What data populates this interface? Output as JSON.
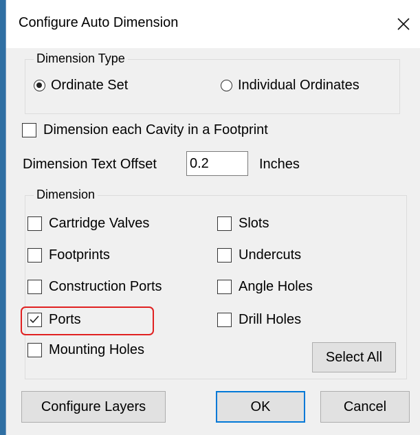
{
  "window": {
    "title": "Configure Auto Dimension",
    "close_icon": "close-icon"
  },
  "dimension_type": {
    "label": "Dimension Type",
    "options": [
      {
        "label": "Ordinate Set",
        "selected": true
      },
      {
        "label": "Individual Ordinates",
        "selected": false
      }
    ]
  },
  "cavity_checkbox": {
    "label": "Dimension each Cavity in a Footprint",
    "checked": false
  },
  "text_offset": {
    "label": "Dimension Text Offset",
    "value": "0.2",
    "unit": "Inches"
  },
  "dimension_group": {
    "label": "Dimension",
    "left_items": [
      {
        "label": "Cartridge Valves",
        "checked": false
      },
      {
        "label": "Footprints",
        "checked": false
      },
      {
        "label": "Construction Ports",
        "checked": false
      },
      {
        "label": "Ports",
        "checked": true
      },
      {
        "label": "Mounting Holes",
        "checked": false
      }
    ],
    "right_items": [
      {
        "label": "Slots",
        "checked": false
      },
      {
        "label": "Undercuts",
        "checked": false
      },
      {
        "label": "Angle Holes",
        "checked": false
      },
      {
        "label": "Drill Holes",
        "checked": false
      }
    ],
    "select_all_label": "Select All"
  },
  "buttons": {
    "configure_layers": "Configure Layers",
    "ok": "OK",
    "cancel": "Cancel"
  },
  "colors": {
    "highlight": "#e02020",
    "default_button_border": "#0078d7"
  }
}
